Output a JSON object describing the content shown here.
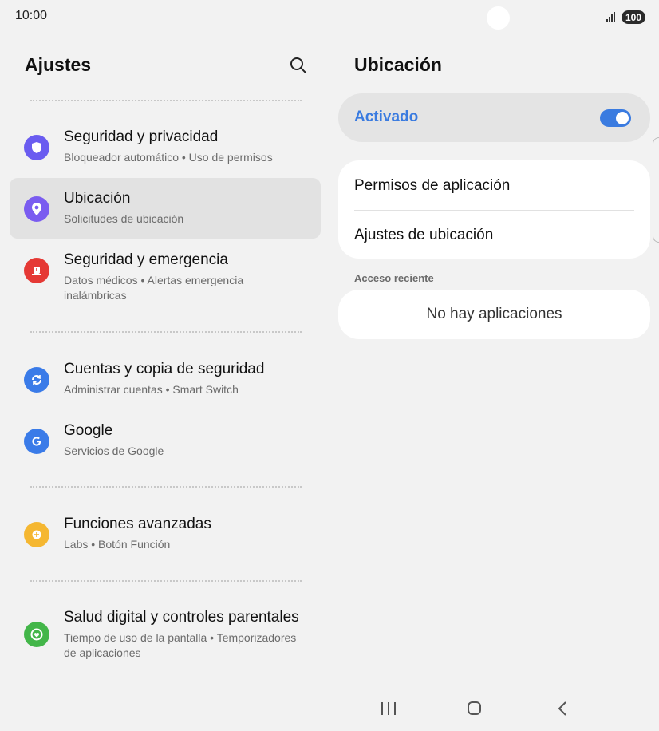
{
  "status_bar": {
    "time": "10:00",
    "battery": "100"
  },
  "left_panel": {
    "title": "Ajustes",
    "items": [
      {
        "title": "Seguridad y privacidad",
        "subtitle": "Bloqueador automático  •  Uso de permisos",
        "icon": "shield-icon",
        "color": "#6a5cf0"
      },
      {
        "title": "Ubicación",
        "subtitle": "Solicitudes de ubicación",
        "icon": "location-pin-icon",
        "color": "#7a5cf0",
        "selected": true
      },
      {
        "title": "Seguridad y emergencia",
        "subtitle": "Datos médicos  •  Alertas emergencia inalámbricas",
        "icon": "emergency-icon",
        "color": "#e53935"
      },
      {
        "title": "Cuentas y copia de seguridad",
        "subtitle": "Administrar cuentas  •  Smart Switch",
        "icon": "sync-icon",
        "color": "#3a7be8"
      },
      {
        "title": "Google",
        "subtitle": "Servicios de Google",
        "icon": "google-icon",
        "color": "#3a7be8"
      },
      {
        "title": "Funciones avanzadas",
        "subtitle": "Labs  •  Botón Función",
        "icon": "gear-plus-icon",
        "color": "#f5b731"
      },
      {
        "title": "Salud digital y controles parentales",
        "subtitle": "Tiempo de uso de la pantalla  •  Temporizadores de aplicaciones",
        "icon": "digital-wellbeing-icon",
        "color": "#43b649"
      }
    ]
  },
  "right_panel": {
    "title": "Ubicación",
    "toggle_label": "Activado",
    "toggle_on": true,
    "accent": "#3a7be0",
    "menu": [
      "Permisos de aplicación",
      "Ajustes de ubicación"
    ],
    "recent_label": "Acceso reciente",
    "recent_empty": "No hay aplicaciones"
  },
  "nav_bar": {
    "icons": [
      "recents-icon",
      "home-icon",
      "back-icon"
    ]
  }
}
